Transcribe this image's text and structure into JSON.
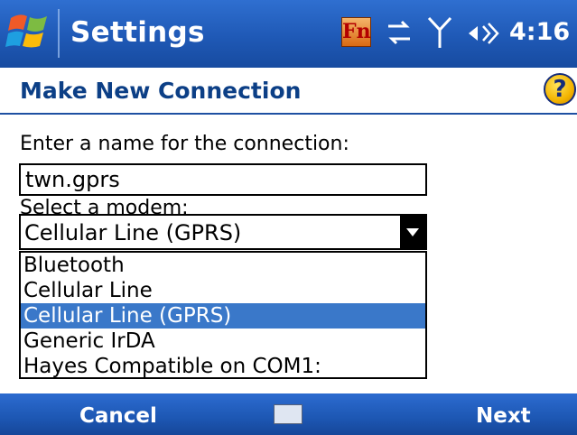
{
  "titlebar": {
    "app_title": "Settings",
    "fn_label": "Fn",
    "clock": "4:16"
  },
  "header": {
    "page_title": "Make New Connection"
  },
  "form": {
    "name_label": "Enter a name for the connection:",
    "name_value": "twn.gprs",
    "modem_label": "Select a modem:",
    "modem_selected": "Cellular Line (GPRS)",
    "modem_options": [
      "Bluetooth",
      "Cellular Line",
      "Cellular Line (GPRS)",
      "Generic IrDA",
      "Hayes Compatible on COM1:"
    ]
  },
  "command_bar": {
    "left_label": "Cancel",
    "right_label": "Next"
  }
}
